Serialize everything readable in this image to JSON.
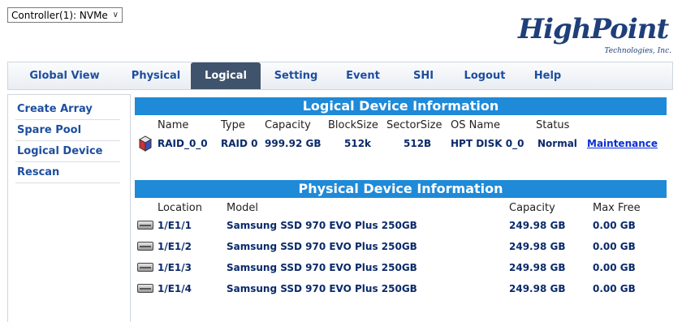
{
  "controller_select": {
    "value": "Controller(1): NVMe"
  },
  "logo": {
    "name": "HighPoint",
    "subtitle": "Technologies, Inc."
  },
  "nav": {
    "tabs": [
      {
        "label": "Global View",
        "active": false
      },
      {
        "label": "Physical",
        "active": false
      },
      {
        "label": "Logical",
        "active": true
      },
      {
        "label": "Setting",
        "active": false
      },
      {
        "label": "Event",
        "active": false
      },
      {
        "label": "SHI",
        "active": false
      },
      {
        "label": "Logout",
        "active": false
      },
      {
        "label": "Help",
        "active": false
      }
    ]
  },
  "sidebar": {
    "items": [
      {
        "label": "Create Array"
      },
      {
        "label": "Spare Pool"
      },
      {
        "label": "Logical Device"
      },
      {
        "label": "Rescan"
      }
    ]
  },
  "logical": {
    "title": "Logical Device Information",
    "headers": [
      "Name",
      "Type",
      "Capacity",
      "BlockSize",
      "SectorSize",
      "OS Name",
      "Status"
    ],
    "row": {
      "name": "RAID_0_0",
      "type": "RAID 0",
      "capacity": "999.92 GB",
      "blocksize": "512k",
      "sectorsize": "512B",
      "os_name": "HPT DISK 0_0",
      "status": "Normal",
      "action": "Maintenance"
    }
  },
  "physical": {
    "title": "Physical Device Information",
    "headers": [
      "Location",
      "Model",
      "Capacity",
      "Max Free"
    ],
    "rows": [
      {
        "location": "1/E1/1",
        "model": "Samsung SSD 970 EVO Plus 250GB",
        "capacity": "249.98 GB",
        "max_free": "0.00 GB"
      },
      {
        "location": "1/E1/2",
        "model": "Samsung SSD 970 EVO Plus 250GB",
        "capacity": "249.98 GB",
        "max_free": "0.00 GB"
      },
      {
        "location": "1/E1/3",
        "model": "Samsung SSD 970 EVO Plus 250GB",
        "capacity": "249.98 GB",
        "max_free": "0.00 GB"
      },
      {
        "location": "1/E1/4",
        "model": "Samsung SSD 970 EVO Plus 250GB",
        "capacity": "249.98 GB",
        "max_free": "0.00 GB"
      }
    ]
  },
  "colors": {
    "accent": "#1f8ad8",
    "active_tab": "#40536c",
    "link": "#1d4e9f"
  }
}
